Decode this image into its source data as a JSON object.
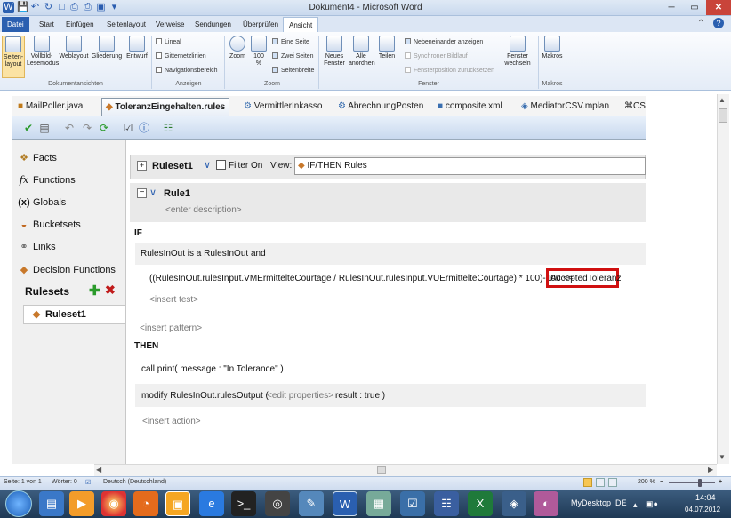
{
  "window": {
    "title": "Dokument4  -  Microsoft Word"
  },
  "ribbon": {
    "tabs": [
      "Datei",
      "Start",
      "Einfügen",
      "Seitenlayout",
      "Verweise",
      "Sendungen",
      "Überprüfen",
      "Ansicht"
    ],
    "groups": {
      "docviews": {
        "label": "Dokumentansichten",
        "items": [
          "Seiten-\nlayout",
          "Vollbild-\nLesemodus",
          "Weblayout",
          "Gliederung",
          "Entwurf"
        ]
      },
      "show": {
        "label": "Anzeigen",
        "items": [
          "Lineal",
          "Gitternetzlinien",
          "Navigationsbereich"
        ]
      },
      "zoom": {
        "label": "Zoom",
        "items": [
          "Zoom",
          "100\n%",
          "Eine Seite",
          "Zwei Seiten",
          "Seitenbreite"
        ]
      },
      "window": {
        "label": "Fenster",
        "items": [
          "Neues\nFenster",
          "Alle\nanordnen",
          "Teilen",
          "Nebeneinander anzeigen",
          "Synchroner Bildlauf",
          "Fensterposition zurücksetzen",
          "Fenster\nwechseln"
        ]
      },
      "macros": {
        "label": "Makros",
        "items": [
          "Makros"
        ]
      }
    }
  },
  "editor_tabs": [
    "MailPoller.java",
    "ToleranzEingehalten.rules",
    "VermittlerInkasso",
    "AbrechnungPosten",
    "composite.xml",
    "MediatorCSV.mplan",
    "CS"
  ],
  "nav": {
    "items": [
      "Facts",
      "Functions",
      "Globals",
      "Bucketsets",
      "Links",
      "Decision Functions"
    ],
    "rulesets_label": "Rulesets",
    "ruleset_item": "Ruleset1"
  },
  "ruleset": {
    "name": "Ruleset1",
    "filter_label": "Filter On",
    "view_label": "View:",
    "view_value": "IF/THEN Rules"
  },
  "rule": {
    "name": "Rule1",
    "description_placeholder": "<enter description>",
    "if_label": "IF",
    "pattern": "RulesInOut is a RulesInOut  and",
    "test_expr": "((RulesInOut.rulesInput.VMErmittelteCourtage / RulesInOut.rulesInput.VUErmittelteCourtage) * 100)-100  <=",
    "test_value": "AcceptedToleranz",
    "insert_test": "<insert test>",
    "insert_pattern": "<insert pattern>",
    "then_label": "THEN",
    "action_print": "call print( message : \"In Tolerance\" )",
    "action_modify": "modify RulesInOut.rulesOutput (",
    "edit_properties": "<edit properties>",
    "action_modify_tail": "result : true  )",
    "insert_action": "<insert action>"
  },
  "status": {
    "page": "Seite: 1 von 1",
    "words": "Wörter: 0",
    "language": "Deutsch (Deutschland)",
    "zoom": "200 %"
  },
  "taskbar": {
    "desktop": "MyDesktop",
    "lang": "DE",
    "time": "14:04",
    "date": "04.07.2012"
  },
  "colors": {
    "accent": "#2a5fb0",
    "highlight_border": "#d01010"
  }
}
